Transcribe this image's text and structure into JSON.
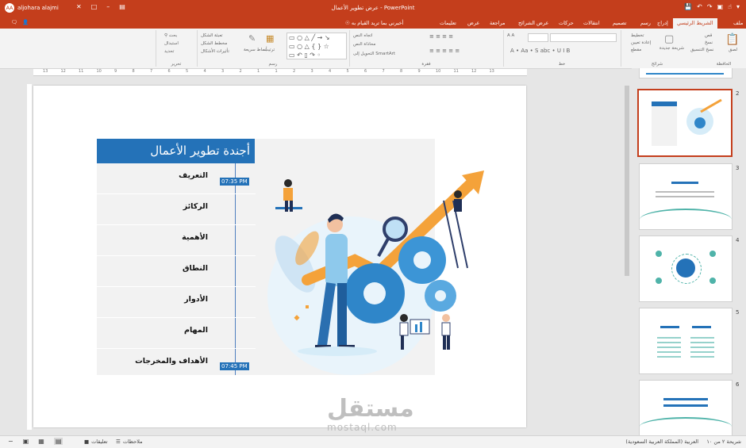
{
  "titlebar": {
    "title": "عرض تطوير الأعمال - PowerPoint",
    "user_name": "aljohara alajmi",
    "user_initials": "AA"
  },
  "tabs": [
    {
      "label": "ملف"
    },
    {
      "label": "الشريط الرئيسي",
      "active": true
    },
    {
      "label": "إدراج"
    },
    {
      "label": "رسم"
    },
    {
      "label": "تصميم"
    },
    {
      "label": "انتقالات"
    },
    {
      "label": "حركات"
    },
    {
      "label": "عرض الشرائح"
    },
    {
      "label": "مراجعة"
    },
    {
      "label": "عرض"
    },
    {
      "label": "تعليمات"
    },
    {
      "label": "أخبرني بما تريد القيام به"
    }
  ],
  "ribbon": {
    "groups": {
      "clipboard": "الحافظة",
      "slides": "شرائح",
      "font": "خط",
      "paragraph": "فقرة",
      "drawing": "رسم",
      "editing": "تحرير"
    },
    "clipboard_items": [
      "لصق",
      "قص",
      "نسخ",
      "نسخ التنسيق"
    ],
    "slides_items": [
      "شريحة جديدة",
      "تخطيط",
      "إعادة تعيين",
      "مقطع"
    ],
    "paragraph_items": [
      "اتجاه النص",
      "محاذاة النص",
      "التحويل إلى SmartArt"
    ],
    "drawing_items": [
      "ترتيب",
      "أنماط سريعة",
      "تعبئة الشكل",
      "مخطط الشكل",
      "تأثيرات الأشكال"
    ],
    "editing_items": [
      "بحث",
      "استبدال",
      "تحديد"
    ]
  },
  "ruler_labels": [
    "13",
    "12",
    "11",
    "10",
    "9",
    "8",
    "7",
    "6",
    "5",
    "4",
    "3",
    "2",
    "1",
    "1",
    "2",
    "3",
    "4",
    "5",
    "6",
    "7",
    "8",
    "9",
    "10",
    "11",
    "12",
    "13"
  ],
  "slide": {
    "title": "أجندة تطوير الأعمال",
    "items": [
      "التعريف",
      "الركائز",
      "الأهمية",
      "النطاق",
      "الأدوار",
      "المهام",
      "الأهداف والمخرجات"
    ],
    "time_start": "07:35 PM",
    "time_end": "07:45 PM",
    "colors": {
      "accent": "#2472b8",
      "orange": "#f4a23a",
      "light_blue": "#d6ecf8"
    }
  },
  "thumbnails": [
    {
      "number": "2",
      "selected": true
    },
    {
      "number": "3",
      "selected": false
    },
    {
      "number": "4",
      "selected": false
    },
    {
      "number": "5",
      "selected": false
    },
    {
      "number": "6",
      "selected": false
    }
  ],
  "status": {
    "slide_info": "شريحة ٢ من ١٠",
    "language": "العربية (المملكة العربية السعودية)",
    "notes": "ملاحظات",
    "comments": "تعليقات"
  },
  "watermark": {
    "brand": "مستقل",
    "domain": "mostaql.com"
  }
}
